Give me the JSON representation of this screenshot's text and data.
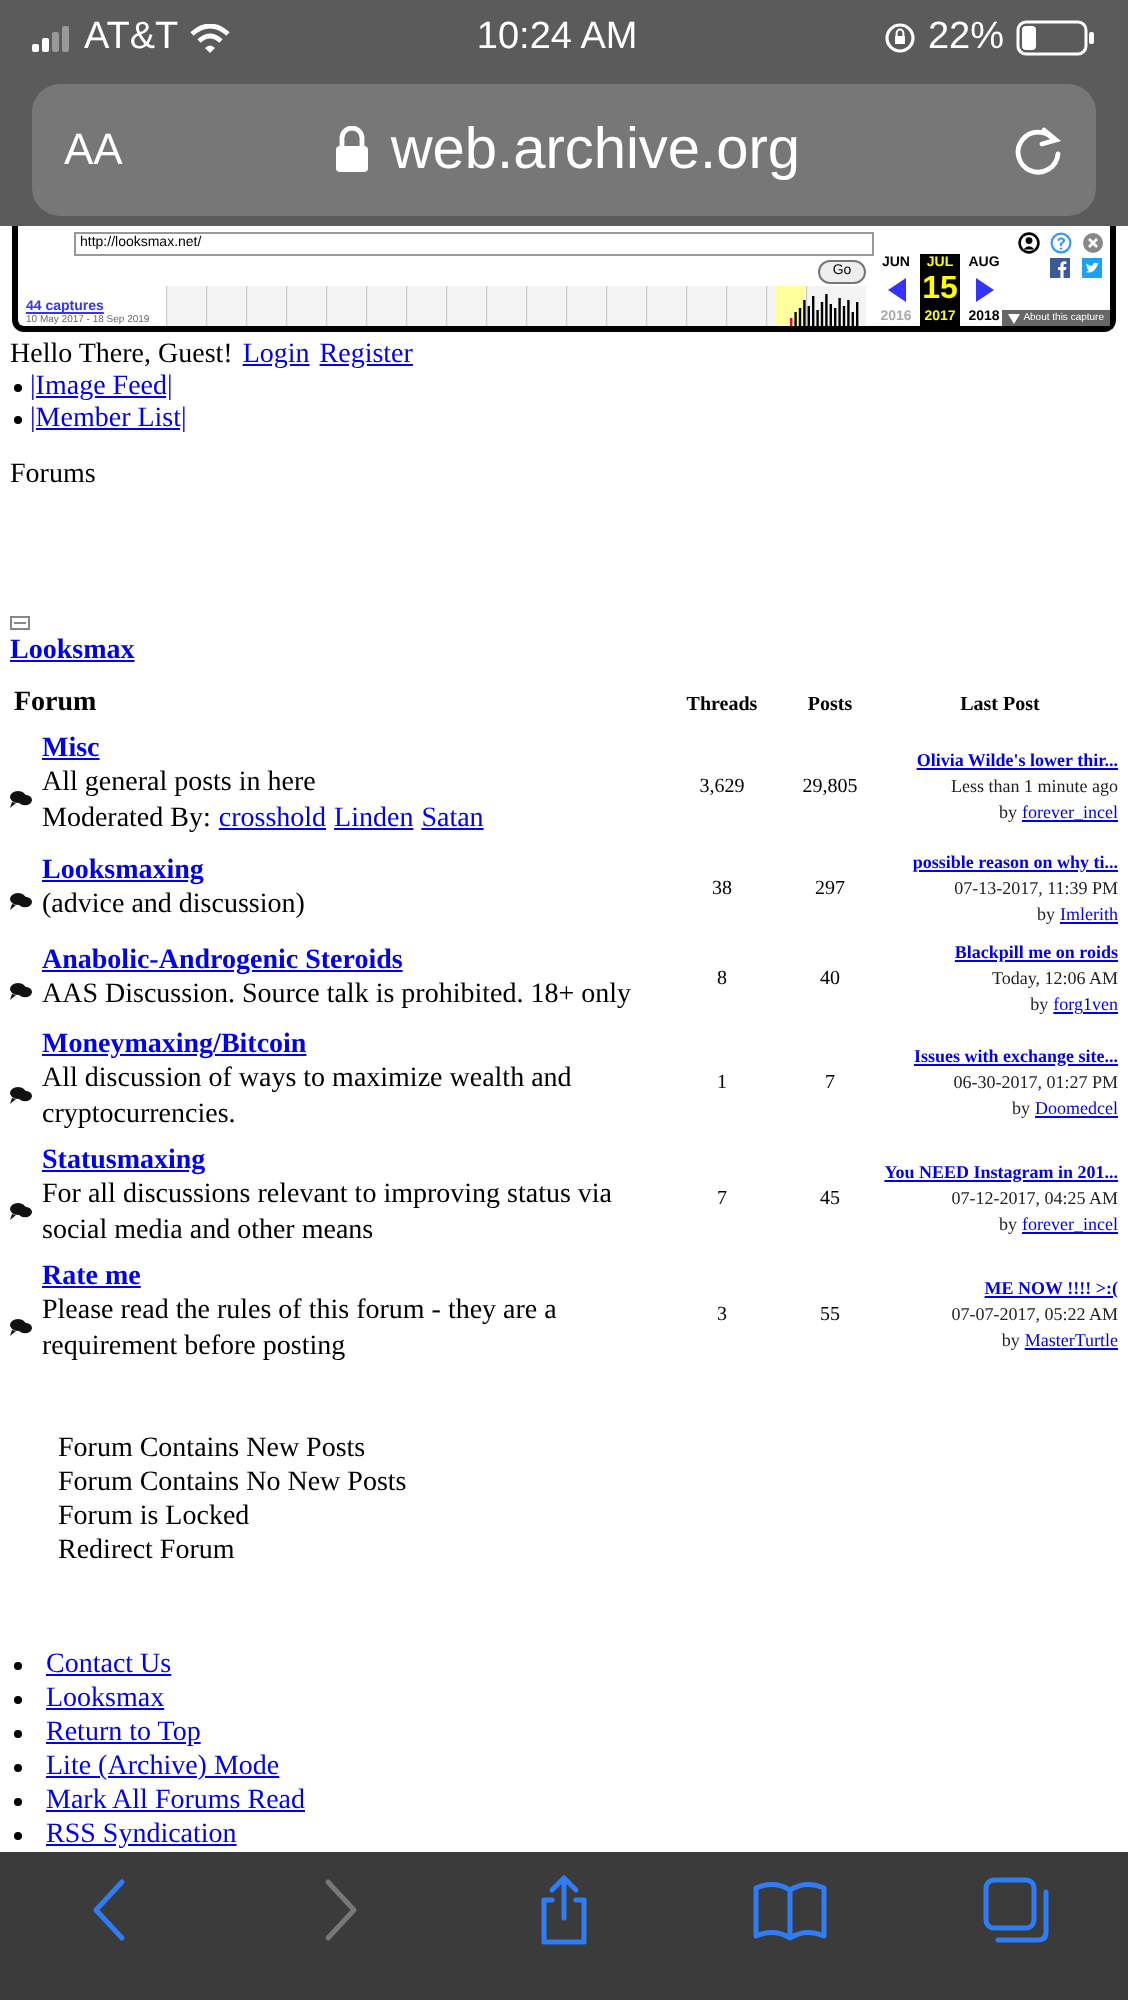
{
  "status_bar": {
    "carrier": "AT&T",
    "time": "10:24 AM",
    "battery": "22%"
  },
  "address_bar": {
    "text_size": "AA",
    "url": "web.archive.org"
  },
  "wayback": {
    "url_field": "http://looksmax.net/",
    "go": "Go",
    "captures": "44 captures",
    "range": "10 May 2017 - 18 Sep 2019",
    "months": [
      {
        "label": "JUN",
        "selected": false
      },
      {
        "label": "JUL",
        "selected": true
      },
      {
        "label": "AUG",
        "selected": false
      }
    ],
    "day": "15",
    "years": [
      {
        "label": "2016",
        "selected": false
      },
      {
        "label": "2017",
        "selected": true
      },
      {
        "label": "2018",
        "selected": false
      }
    ],
    "about": "About this capture"
  },
  "header": {
    "greeting": "Hello There, Guest!",
    "login": "Login",
    "register": "Register"
  },
  "nav_links": [
    "|Image Feed|",
    "|Member List|"
  ],
  "heading": "Forums",
  "category": "Looksmax",
  "table": {
    "columns": [
      "Forum",
      "Threads",
      "Posts",
      "Last Post"
    ],
    "rows": [
      {
        "title": "Misc",
        "description": "All general posts in here",
        "moderators_label": "Moderated By:",
        "moderators": [
          "crosshold",
          "Linden",
          "Satan"
        ],
        "threads": "3,629",
        "posts": "29,805",
        "last_title": "Olivia Wilde's lower thir...",
        "last_time": "Less than 1 minute ago",
        "by": "by",
        "last_user": "forever_incel"
      },
      {
        "title": "Looksmaxing",
        "description": "(advice and discussion)",
        "threads": "38",
        "posts": "297",
        "last_title": "possible reason on why ti...",
        "last_time": "07-13-2017, 11:39 PM",
        "by": "by",
        "last_user": "Imlerith"
      },
      {
        "title": "Anabolic-Androgenic Steroids",
        "description": "AAS Discussion. Source talk is prohibited. 18+ only",
        "threads": "8",
        "posts": "40",
        "last_title": "Blackpill me on roids",
        "last_time": "Today, 12:06 AM",
        "by": "by",
        "last_user": "forg1ven"
      },
      {
        "title": "Moneymaxing/Bitcoin",
        "description": "All discussion of ways to maximize wealth and cryptocurrencies.",
        "threads": "1",
        "posts": "7",
        "last_title": "Issues with exchange site...",
        "last_time": "06-30-2017, 01:27 PM",
        "by": "by",
        "last_user": "Doomedcel"
      },
      {
        "title": "Statusmaxing",
        "description": "For all discussions relevant to improving status via social media and other means",
        "threads": "7",
        "posts": "45",
        "last_title": "You NEED Instagram in 201...",
        "last_time": "07-12-2017, 04:25 AM",
        "by": "by",
        "last_user": "forever_incel"
      },
      {
        "title": "Rate me",
        "description": "Please read the rules of this forum - they are a requirement before posting",
        "threads": "3",
        "posts": "55",
        "last_title": "ME NOW !!!! >:(",
        "last_time": "07-07-2017, 05:22 AM",
        "by": "by",
        "last_user": "MasterTurtle"
      }
    ]
  },
  "legend": [
    "Forum Contains New Posts",
    "Forum Contains No New Posts",
    "Forum is Locked",
    "Redirect Forum"
  ],
  "footer_links": [
    "Contact Us",
    "Looksmax",
    "Return to Top",
    "Lite (Archive) Mode",
    "Mark All Forums Read",
    "RSS Syndication"
  ],
  "toolbar": {
    "back_disabled": false,
    "forward_disabled": true
  }
}
